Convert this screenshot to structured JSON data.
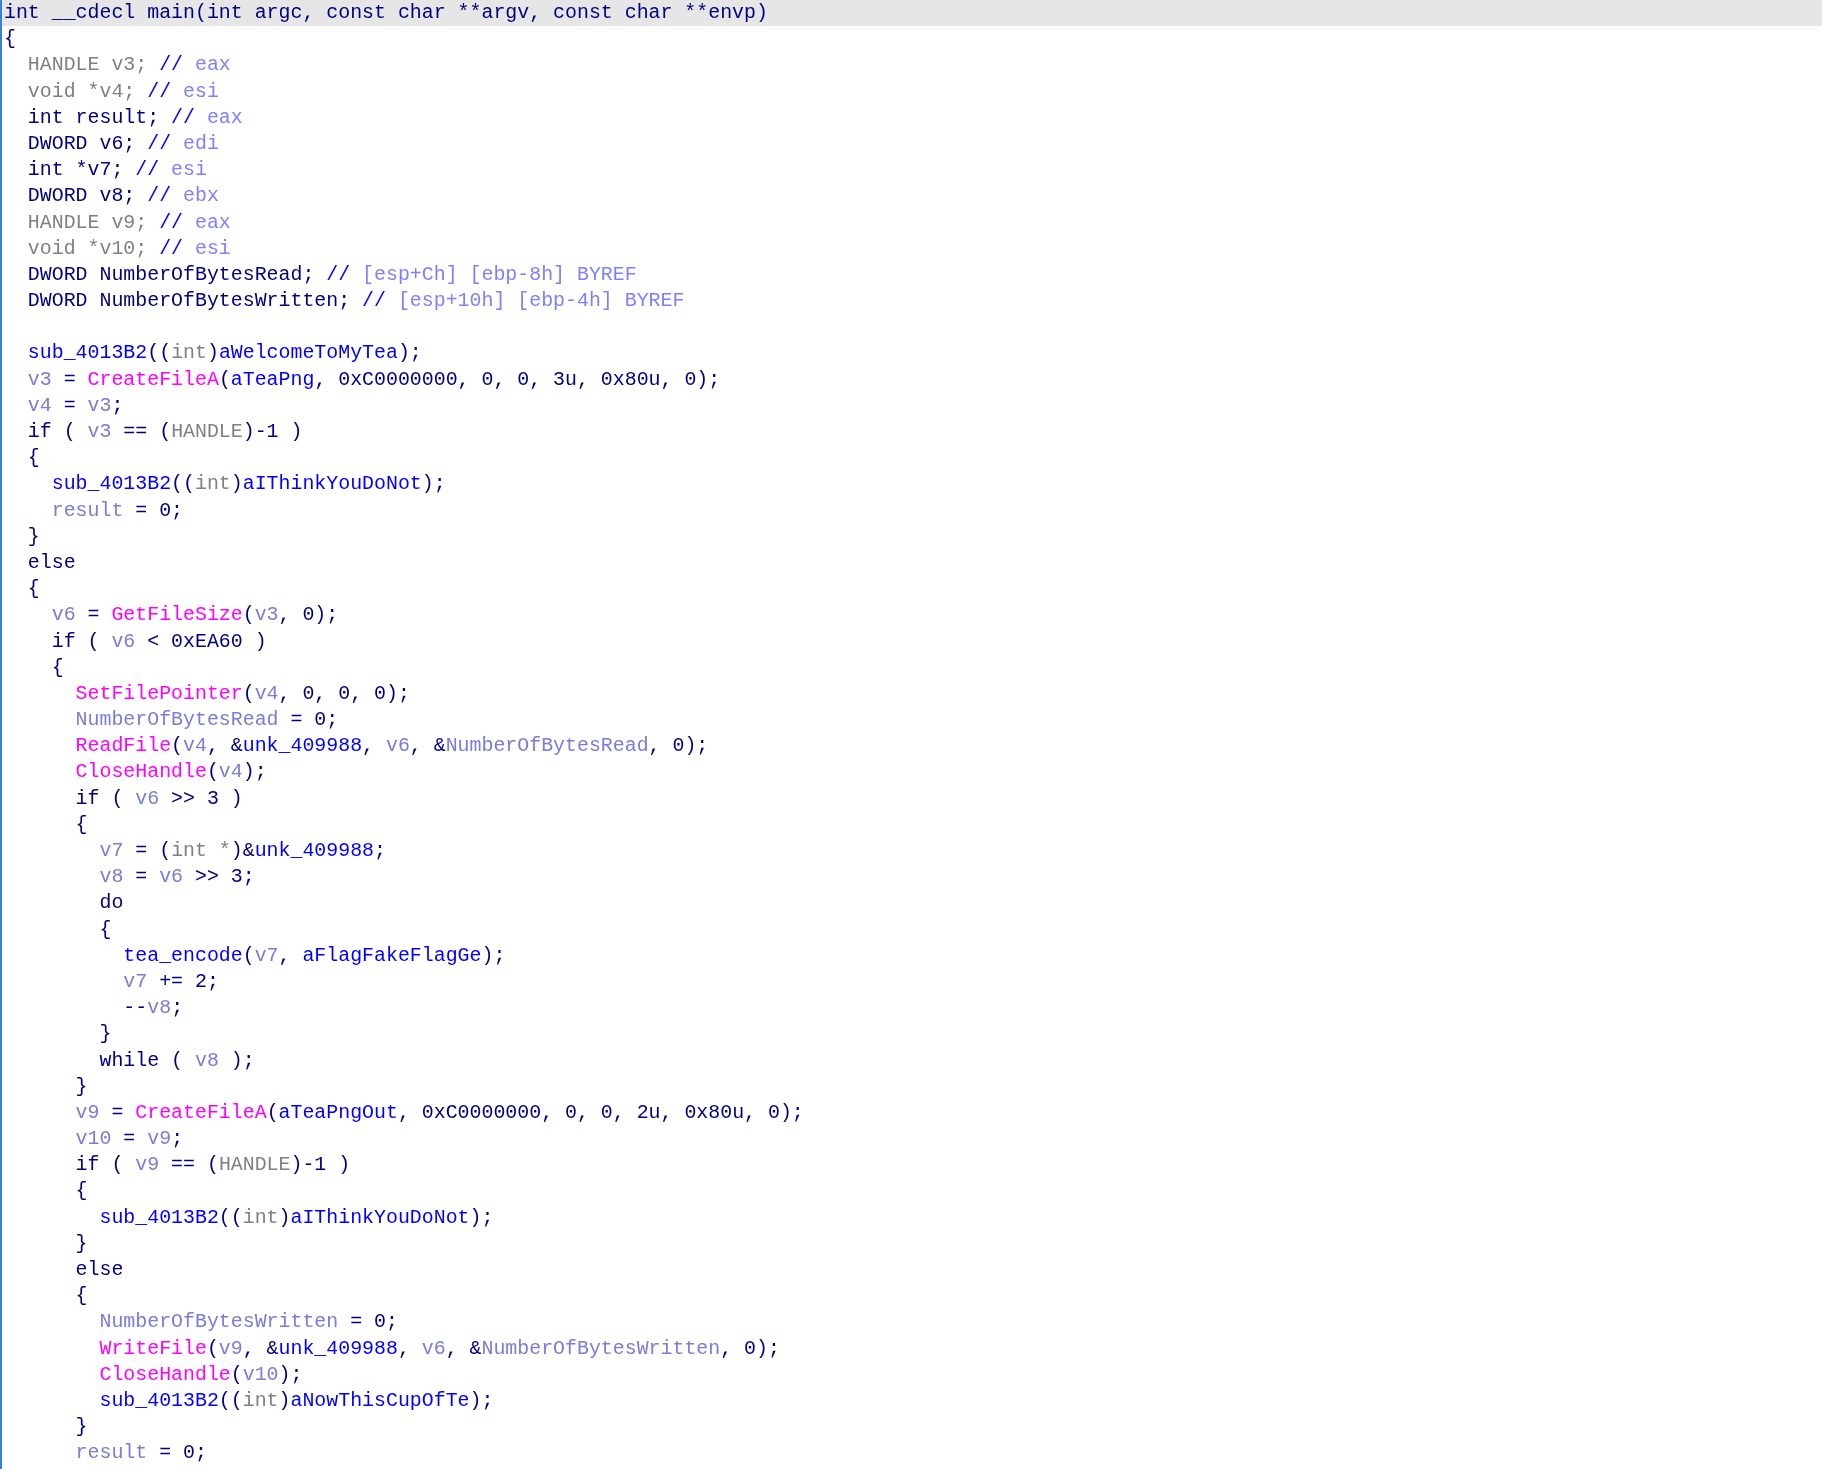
{
  "lines": [
    {
      "highlighted": true,
      "tokens": [
        {
          "kind": "code",
          "text": "int __cdecl main(int argc, const char **argv, const char **envp)"
        }
      ]
    },
    {
      "highlighted": false,
      "tokens": [
        {
          "kind": "code",
          "text": "{"
        }
      ]
    },
    {
      "highlighted": false,
      "tokens": [
        {
          "kind": "type",
          "text": "  HANDLE v3;"
        },
        {
          "kind": "name",
          "text": " //"
        },
        {
          "kind": "comment",
          "text": " eax"
        }
      ]
    },
    {
      "highlighted": false,
      "tokens": [
        {
          "kind": "type",
          "text": "  void *v4;"
        },
        {
          "kind": "name",
          "text": " //"
        },
        {
          "kind": "comment",
          "text": " esi"
        }
      ]
    },
    {
      "highlighted": false,
      "tokens": [
        {
          "kind": "code",
          "text": "  int result;"
        },
        {
          "kind": "name",
          "text": " //"
        },
        {
          "kind": "comment",
          "text": " eax"
        }
      ]
    },
    {
      "highlighted": false,
      "tokens": [
        {
          "kind": "code",
          "text": "  DWORD v6;"
        },
        {
          "kind": "name",
          "text": " //"
        },
        {
          "kind": "comment",
          "text": " edi"
        }
      ]
    },
    {
      "highlighted": false,
      "tokens": [
        {
          "kind": "code",
          "text": "  int *v7;"
        },
        {
          "kind": "name",
          "text": " //"
        },
        {
          "kind": "comment",
          "text": " esi"
        }
      ]
    },
    {
      "highlighted": false,
      "tokens": [
        {
          "kind": "code",
          "text": "  DWORD v8;"
        },
        {
          "kind": "name",
          "text": " //"
        },
        {
          "kind": "comment",
          "text": " ebx"
        }
      ]
    },
    {
      "highlighted": false,
      "tokens": [
        {
          "kind": "type",
          "text": "  HANDLE v9;"
        },
        {
          "kind": "name",
          "text": " //"
        },
        {
          "kind": "comment",
          "text": " eax"
        }
      ]
    },
    {
      "highlighted": false,
      "tokens": [
        {
          "kind": "type",
          "text": "  void *v10;"
        },
        {
          "kind": "name",
          "text": " //"
        },
        {
          "kind": "comment",
          "text": " esi"
        }
      ]
    },
    {
      "highlighted": false,
      "tokens": [
        {
          "kind": "code",
          "text": "  DWORD NumberOfBytesRead;"
        },
        {
          "kind": "name",
          "text": " //"
        },
        {
          "kind": "comment",
          "text": " [esp+Ch] [ebp-8h] BYREF"
        }
      ]
    },
    {
      "highlighted": false,
      "tokens": [
        {
          "kind": "code",
          "text": "  DWORD NumberOfBytesWritten;"
        },
        {
          "kind": "name",
          "text": " //"
        },
        {
          "kind": "comment",
          "text": " [esp+10h] [ebp-4h] BYREF"
        }
      ]
    },
    {
      "highlighted": false
    },
    {
      "highlighted": false,
      "tokens": [
        {
          "kind": "name",
          "text": "  sub_4013B2"
        },
        {
          "kind": "code",
          "text": "(("
        },
        {
          "kind": "type",
          "text": "int"
        },
        {
          "kind": "code",
          "text": ")"
        },
        {
          "kind": "name",
          "text": "aWelcomeToMyTea"
        },
        {
          "kind": "code",
          "text": ");"
        }
      ]
    },
    {
      "highlighted": false,
      "tokens": [
        {
          "kind": "var",
          "text": "  v3"
        },
        {
          "kind": "code",
          "text": " = "
        },
        {
          "kind": "import",
          "text": "CreateFileA"
        },
        {
          "kind": "code",
          "text": "("
        },
        {
          "kind": "name",
          "text": "aTeaPng"
        },
        {
          "kind": "code",
          "text": ", 0xC0000000, 0, 0, 3u, 0x80u, 0);"
        }
      ]
    },
    {
      "highlighted": false,
      "tokens": [
        {
          "kind": "var",
          "text": "  v4"
        },
        {
          "kind": "code",
          "text": " = "
        },
        {
          "kind": "var",
          "text": "v3"
        },
        {
          "kind": "code",
          "text": ";"
        }
      ]
    },
    {
      "highlighted": false,
      "tokens": [
        {
          "kind": "code",
          "text": "  if ( "
        },
        {
          "kind": "var",
          "text": "v3"
        },
        {
          "kind": "code",
          "text": " == ("
        },
        {
          "kind": "type",
          "text": "HANDLE"
        },
        {
          "kind": "code",
          "text": ")-1 )"
        }
      ]
    },
    {
      "highlighted": false,
      "tokens": [
        {
          "kind": "code",
          "text": "  {"
        }
      ]
    },
    {
      "highlighted": false,
      "tokens": [
        {
          "kind": "name",
          "text": "    sub_4013B2"
        },
        {
          "kind": "code",
          "text": "(("
        },
        {
          "kind": "type",
          "text": "int"
        },
        {
          "kind": "code",
          "text": ")"
        },
        {
          "kind": "name",
          "text": "aIThinkYouDoNot"
        },
        {
          "kind": "code",
          "text": ");"
        }
      ]
    },
    {
      "highlighted": false,
      "tokens": [
        {
          "kind": "var",
          "text": "    result"
        },
        {
          "kind": "code",
          "text": " = 0;"
        }
      ]
    },
    {
      "highlighted": false,
      "tokens": [
        {
          "kind": "code",
          "text": "  }"
        }
      ]
    },
    {
      "highlighted": false,
      "tokens": [
        {
          "kind": "code",
          "text": "  else"
        }
      ]
    },
    {
      "highlighted": false,
      "tokens": [
        {
          "kind": "code",
          "text": "  {"
        }
      ]
    },
    {
      "highlighted": false,
      "tokens": [
        {
          "kind": "var",
          "text": "    v6"
        },
        {
          "kind": "code",
          "text": " = "
        },
        {
          "kind": "import",
          "text": "GetFileSize"
        },
        {
          "kind": "code",
          "text": "("
        },
        {
          "kind": "var",
          "text": "v3"
        },
        {
          "kind": "code",
          "text": ", 0);"
        }
      ]
    },
    {
      "highlighted": false,
      "tokens": [
        {
          "kind": "code",
          "text": "    if ( "
        },
        {
          "kind": "var",
          "text": "v6"
        },
        {
          "kind": "code",
          "text": " < 0xEA60 )"
        }
      ]
    },
    {
      "highlighted": false,
      "tokens": [
        {
          "kind": "code",
          "text": "    {"
        }
      ]
    },
    {
      "highlighted": false,
      "tokens": [
        {
          "kind": "import",
          "text": "      SetFilePointer"
        },
        {
          "kind": "code",
          "text": "("
        },
        {
          "kind": "var",
          "text": "v4"
        },
        {
          "kind": "code",
          "text": ", 0, 0, 0);"
        }
      ]
    },
    {
      "highlighted": false,
      "tokens": [
        {
          "kind": "var",
          "text": "      NumberOfBytesRead"
        },
        {
          "kind": "code",
          "text": " = 0;"
        }
      ]
    },
    {
      "highlighted": false,
      "tokens": [
        {
          "kind": "import",
          "text": "      ReadFile"
        },
        {
          "kind": "code",
          "text": "("
        },
        {
          "kind": "var",
          "text": "v4"
        },
        {
          "kind": "code",
          "text": ", &"
        },
        {
          "kind": "name",
          "text": "unk_409988"
        },
        {
          "kind": "code",
          "text": ", "
        },
        {
          "kind": "var",
          "text": "v6"
        },
        {
          "kind": "code",
          "text": ", &"
        },
        {
          "kind": "var",
          "text": "NumberOfBytesRead"
        },
        {
          "kind": "code",
          "text": ", 0);"
        }
      ]
    },
    {
      "highlighted": false,
      "tokens": [
        {
          "kind": "import",
          "text": "      CloseHandle"
        },
        {
          "kind": "code",
          "text": "("
        },
        {
          "kind": "var",
          "text": "v4"
        },
        {
          "kind": "code",
          "text": ");"
        }
      ]
    },
    {
      "highlighted": false,
      "tokens": [
        {
          "kind": "code",
          "text": "      if ( "
        },
        {
          "kind": "var",
          "text": "v6"
        },
        {
          "kind": "code",
          "text": " >> 3 )"
        }
      ]
    },
    {
      "highlighted": false,
      "tokens": [
        {
          "kind": "code",
          "text": "      {"
        }
      ]
    },
    {
      "highlighted": false,
      "tokens": [
        {
          "kind": "var",
          "text": "        v7"
        },
        {
          "kind": "code",
          "text": " = ("
        },
        {
          "kind": "type",
          "text": "int *"
        },
        {
          "kind": "code",
          "text": ")&"
        },
        {
          "kind": "name",
          "text": "unk_409988"
        },
        {
          "kind": "code",
          "text": ";"
        }
      ]
    },
    {
      "highlighted": false,
      "tokens": [
        {
          "kind": "var",
          "text": "        v8"
        },
        {
          "kind": "code",
          "text": " = "
        },
        {
          "kind": "var",
          "text": "v6"
        },
        {
          "kind": "code",
          "text": " >> 3;"
        }
      ]
    },
    {
      "highlighted": false,
      "tokens": [
        {
          "kind": "code",
          "text": "        do"
        }
      ]
    },
    {
      "highlighted": false,
      "tokens": [
        {
          "kind": "code",
          "text": "        {"
        }
      ]
    },
    {
      "highlighted": false,
      "tokens": [
        {
          "kind": "name",
          "text": "          tea_encode"
        },
        {
          "kind": "code",
          "text": "("
        },
        {
          "kind": "var",
          "text": "v7"
        },
        {
          "kind": "code",
          "text": ", "
        },
        {
          "kind": "name",
          "text": "aFlagFakeFlagGe"
        },
        {
          "kind": "code",
          "text": ");"
        }
      ]
    },
    {
      "highlighted": false,
      "tokens": [
        {
          "kind": "var",
          "text": "          v7"
        },
        {
          "kind": "code",
          "text": " += 2;"
        }
      ]
    },
    {
      "highlighted": false,
      "tokens": [
        {
          "kind": "code",
          "text": "          --"
        },
        {
          "kind": "var",
          "text": "v8"
        },
        {
          "kind": "code",
          "text": ";"
        }
      ]
    },
    {
      "highlighted": false,
      "tokens": [
        {
          "kind": "code",
          "text": "        }"
        }
      ]
    },
    {
      "highlighted": false,
      "tokens": [
        {
          "kind": "code",
          "text": "        while ( "
        },
        {
          "kind": "var",
          "text": "v8"
        },
        {
          "kind": "code",
          "text": " );"
        }
      ]
    },
    {
      "highlighted": false,
      "tokens": [
        {
          "kind": "code",
          "text": "      }"
        }
      ]
    },
    {
      "highlighted": false,
      "tokens": [
        {
          "kind": "var",
          "text": "      v9"
        },
        {
          "kind": "code",
          "text": " = "
        },
        {
          "kind": "import",
          "text": "CreateFileA"
        },
        {
          "kind": "code",
          "text": "("
        },
        {
          "kind": "name",
          "text": "aTeaPngOut"
        },
        {
          "kind": "code",
          "text": ", 0xC0000000, 0, 0, 2u, 0x80u, 0);"
        }
      ]
    },
    {
      "highlighted": false,
      "tokens": [
        {
          "kind": "var",
          "text": "      v10"
        },
        {
          "kind": "code",
          "text": " = "
        },
        {
          "kind": "var",
          "text": "v9"
        },
        {
          "kind": "code",
          "text": ";"
        }
      ]
    },
    {
      "highlighted": false,
      "tokens": [
        {
          "kind": "code",
          "text": "      if ( "
        },
        {
          "kind": "var",
          "text": "v9"
        },
        {
          "kind": "code",
          "text": " == ("
        },
        {
          "kind": "type",
          "text": "HANDLE"
        },
        {
          "kind": "code",
          "text": ")-1 )"
        }
      ]
    },
    {
      "highlighted": false,
      "tokens": [
        {
          "kind": "code",
          "text": "      {"
        }
      ]
    },
    {
      "highlighted": false,
      "tokens": [
        {
          "kind": "name",
          "text": "        sub_4013B2"
        },
        {
          "kind": "code",
          "text": "(("
        },
        {
          "kind": "type",
          "text": "int"
        },
        {
          "kind": "code",
          "text": ")"
        },
        {
          "kind": "name",
          "text": "aIThinkYouDoNot"
        },
        {
          "kind": "code",
          "text": ");"
        }
      ]
    },
    {
      "highlighted": false,
      "tokens": [
        {
          "kind": "code",
          "text": "      }"
        }
      ]
    },
    {
      "highlighted": false,
      "tokens": [
        {
          "kind": "code",
          "text": "      else"
        }
      ]
    },
    {
      "highlighted": false,
      "tokens": [
        {
          "kind": "code",
          "text": "      {"
        }
      ]
    },
    {
      "highlighted": false,
      "tokens": [
        {
          "kind": "var",
          "text": "        NumberOfBytesWritten"
        },
        {
          "kind": "code",
          "text": " = 0;"
        }
      ]
    },
    {
      "highlighted": false,
      "tokens": [
        {
          "kind": "import",
          "text": "        WriteFile"
        },
        {
          "kind": "code",
          "text": "("
        },
        {
          "kind": "var",
          "text": "v9"
        },
        {
          "kind": "code",
          "text": ", &"
        },
        {
          "kind": "name",
          "text": "unk_409988"
        },
        {
          "kind": "code",
          "text": ", "
        },
        {
          "kind": "var",
          "text": "v6"
        },
        {
          "kind": "code",
          "text": ", &"
        },
        {
          "kind": "var",
          "text": "NumberOfBytesWritten"
        },
        {
          "kind": "code",
          "text": ", 0);"
        }
      ]
    },
    {
      "highlighted": false,
      "tokens": [
        {
          "kind": "import",
          "text": "        CloseHandle"
        },
        {
          "kind": "code",
          "text": "("
        },
        {
          "kind": "var",
          "text": "v10"
        },
        {
          "kind": "code",
          "text": ");"
        }
      ]
    },
    {
      "highlighted": false,
      "tokens": [
        {
          "kind": "name",
          "text": "        sub_4013B2"
        },
        {
          "kind": "code",
          "text": "(("
        },
        {
          "kind": "type",
          "text": "int"
        },
        {
          "kind": "code",
          "text": ")"
        },
        {
          "kind": "name",
          "text": "aNowThisCupOfTe"
        },
        {
          "kind": "code",
          "text": ");"
        }
      ]
    },
    {
      "highlighted": false,
      "tokens": [
        {
          "kind": "code",
          "text": "      }"
        }
      ]
    },
    {
      "highlighted": false,
      "tokens": [
        {
          "kind": "var",
          "text": "      result"
        },
        {
          "kind": "code",
          "text": " = 0;"
        }
      ]
    }
  ]
}
